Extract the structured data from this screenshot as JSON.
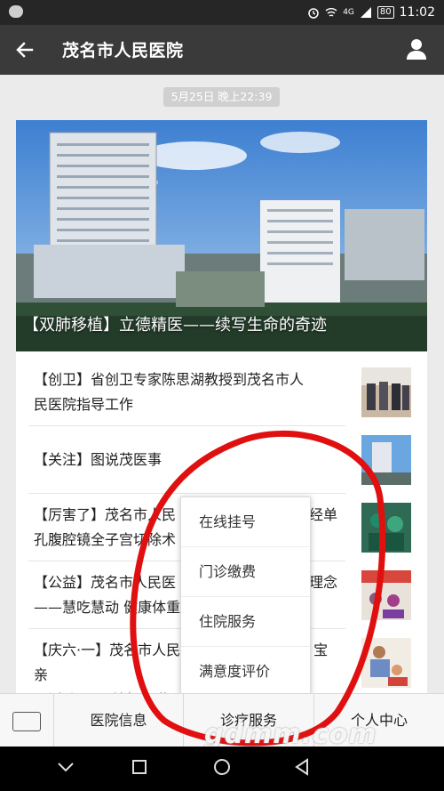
{
  "status_bar": {
    "time": "11:02",
    "battery": "80",
    "network": "4G"
  },
  "header": {
    "title": "茂名市人民医院"
  },
  "message_time": "5月25日 晚上22:39",
  "hero": {
    "caption": "【双肺移植】立德精医——续写生命的奇迹"
  },
  "articles": [
    {
      "text": "【创卫】省创卫专家陈思湖教授到茂名市人民医院指导工作"
    },
    {
      "text": "【关注】图说茂医事"
    },
    {
      "text": "【厉害了】茂名市人民医院…完成首例经单孔腹腔镜全子宫切除术"
    },
    {
      "text": "【公益】茂名市人民医院…理念——慧吃慧动 健康体重"
    },
    {
      "text": "【庆六·一】茂名市人民医院…宝宝亲子活动”，开始报名啦～"
    }
  ],
  "articles_visible": [
    {
      "l1": "【创卫】省创卫专家陈思湖教授到茂名市人",
      "l2": "民医院指导工作"
    },
    {
      "l1": "【关注】图说茂医事",
      "l2": ""
    },
    {
      "l1": "【厉害了】茂名市人民",
      "l1b": "经单",
      "l2": "孔腹腔镜全子宫切除术"
    },
    {
      "l1": "【公益】茂名市人民医",
      "l1b": "理念",
      "l2": "——慧吃慧动 健康体重"
    },
    {
      "l1": "【庆六·一】茂名市人民",
      "l1b": "宝亲",
      "l2": "子活动”，开始报名啦～"
    }
  ],
  "bottom_menu": {
    "tabs": [
      "医院信息",
      "诊疗服务",
      "个人中心"
    ]
  },
  "popup_menu": {
    "items": [
      "在线挂号",
      "门诊缴费",
      "住院服务",
      "满意度评价"
    ]
  },
  "watermark": "gdmm.com"
}
